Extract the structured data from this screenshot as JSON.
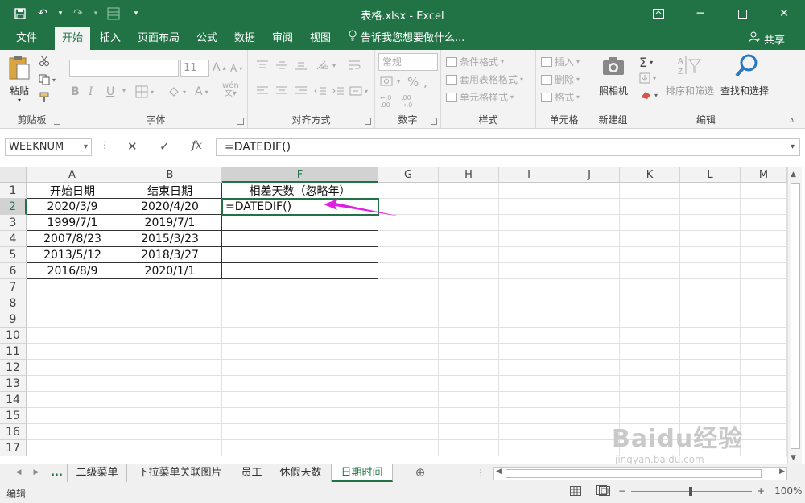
{
  "window": {
    "title": "表格.xlsx - Excel"
  },
  "menu": {
    "tabs": [
      "文件",
      "开始",
      "插入",
      "页面布局",
      "公式",
      "数据",
      "审阅",
      "视图"
    ],
    "active": "开始",
    "tell_me": "告诉我您想要做什么...",
    "share": "共享"
  },
  "ribbon": {
    "clipboard": {
      "label": "剪贴板",
      "paste": "粘贴"
    },
    "font": {
      "label": "字体",
      "size": "11",
      "bold": "B",
      "italic": "I",
      "underline": "U"
    },
    "alignment": {
      "label": "对齐方式"
    },
    "number": {
      "label": "数字",
      "format": "常规"
    },
    "styles": {
      "label": "样式",
      "conditional": "条件格式",
      "table": "套用表格格式",
      "cell": "单元格样式"
    },
    "cells": {
      "label": "单元格",
      "insert": "插入",
      "delete": "删除",
      "format": "格式"
    },
    "newgroup": {
      "label": "新建组",
      "camera": "照相机"
    },
    "editing": {
      "label": "编辑",
      "sort": "排序和筛选",
      "find": "查找和选择"
    }
  },
  "formula_bar": {
    "name_box": "WEEKNUM",
    "formula": "=DATEDIF()"
  },
  "sheet": {
    "columns": [
      "A",
      "B",
      "F",
      "G",
      "H",
      "I",
      "J",
      "K",
      "L",
      "M"
    ],
    "selected_column": "F",
    "rows": [
      "1",
      "2",
      "3",
      "4",
      "5",
      "6",
      "7",
      "8",
      "9",
      "10",
      "11",
      "12",
      "13",
      "14",
      "15",
      "16",
      "17"
    ],
    "selected_row": "2",
    "header_row": [
      "开始日期",
      "结束日期",
      "相差天数（忽略年）"
    ],
    "data": [
      [
        "2020/3/9",
        "2020/4/20",
        "=DATEDIF()"
      ],
      [
        "1999/7/1",
        "2019/7/1",
        ""
      ],
      [
        "2007/8/23",
        "2015/3/23",
        ""
      ],
      [
        "2013/5/12",
        "2018/3/27",
        ""
      ],
      [
        "2016/8/9",
        "2020/1/1",
        ""
      ]
    ]
  },
  "sheet_tabs": {
    "more": "...",
    "tabs": [
      "二级菜单",
      "下拉菜单关联图片",
      "员工",
      "休假天数",
      "日期时间"
    ],
    "active": "日期时间"
  },
  "status_bar": {
    "mode": "编辑",
    "zoom": "100%"
  },
  "annotation": {
    "arrow_color": "#e020e0"
  },
  "watermark": {
    "text": "Baidu经验",
    "url": "jingyan.baidu.com"
  }
}
